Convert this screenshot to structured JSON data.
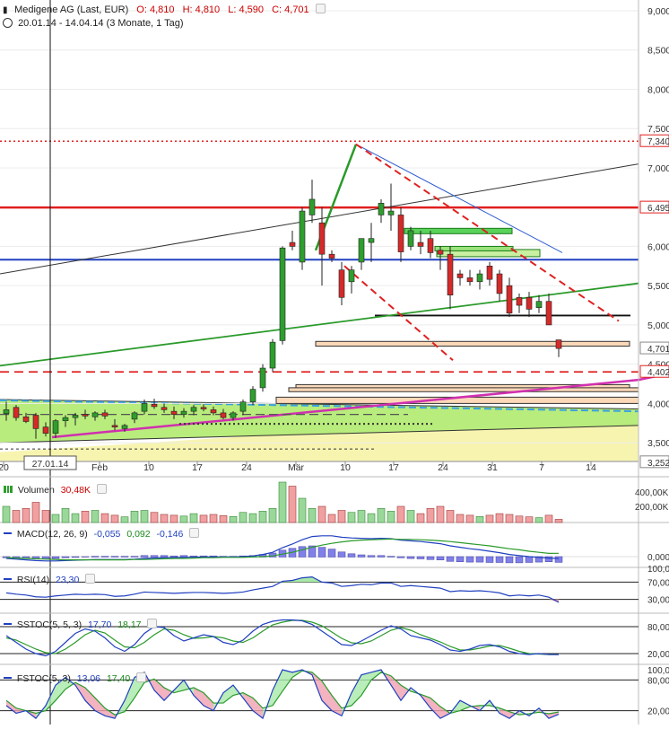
{
  "header": {
    "title": "Medigene AG (Last, EUR)",
    "open_label": "O:",
    "open": "4,810",
    "high_label": "H:",
    "high": "4,810",
    "low_label": "L:",
    "low": "4,590",
    "close_label": "C:",
    "close": "4,701",
    "period": "20.01.14 - 14.04.14 (3 Monate, 1 Tag)"
  },
  "colors": {
    "up": "#2e9e2e",
    "down": "#d42a2a",
    "red_line": "#e02020",
    "blue_line": "#2040c0",
    "green_line": "#2a9a2a",
    "magenta": "#d030b0",
    "orange_fill": "#fbd8b8",
    "green_zone": "#b8ec7c",
    "yellow_zone": "#f7f4b0"
  },
  "chart_data": [
    {
      "type": "candlestick",
      "name": "main",
      "x_ticks": [
        "20",
        "Feb",
        "10",
        "17",
        "24",
        "Mär",
        "10",
        "17",
        "24",
        "31",
        "7",
        "14"
      ],
      "crosshair_date": "27.01.14",
      "y_ticks": [
        "9,000",
        "8,500",
        "8,000",
        "7,500",
        "7,000",
        "6,500",
        "6,000",
        "5,500",
        "5,000",
        "4,500",
        "4,000",
        "3,500"
      ],
      "price_labels": [
        "7,340",
        "6,495",
        "4,701",
        "4,402",
        "3,252"
      ],
      "ylim": [
        3.25,
        9.0
      ],
      "candles": [
        [
          3.87,
          4.02,
          3.78,
          3.92
        ],
        [
          3.95,
          3.98,
          3.78,
          3.82
        ],
        [
          3.83,
          3.88,
          3.75,
          3.77
        ],
        [
          3.85,
          3.88,
          3.55,
          3.68
        ],
        [
          3.7,
          3.76,
          3.58,
          3.62
        ],
        [
          3.62,
          3.8,
          3.56,
          3.78
        ],
        [
          3.78,
          3.85,
          3.7,
          3.82
        ],
        [
          3.82,
          3.88,
          3.72,
          3.85
        ],
        [
          3.86,
          3.92,
          3.8,
          3.84
        ],
        [
          3.83,
          3.9,
          3.78,
          3.88
        ],
        [
          3.88,
          3.92,
          3.8,
          3.84
        ],
        [
          3.72,
          3.8,
          3.66,
          3.7
        ],
        [
          3.68,
          3.74,
          3.64,
          3.72
        ],
        [
          3.8,
          3.9,
          3.75,
          3.88
        ],
        [
          3.9,
          4.05,
          3.86,
          4.0
        ],
        [
          3.99,
          4.06,
          3.93,
          3.96
        ],
        [
          3.95,
          4.0,
          3.88,
          3.92
        ],
        [
          3.9,
          3.96,
          3.8,
          3.86
        ],
        [
          3.86,
          3.94,
          3.82,
          3.9
        ],
        [
          3.9,
          3.98,
          3.85,
          3.95
        ],
        [
          3.95,
          3.99,
          3.9,
          3.93
        ],
        [
          3.92,
          3.96,
          3.85,
          3.88
        ],
        [
          3.88,
          3.93,
          3.8,
          3.82
        ],
        [
          3.82,
          3.9,
          3.78,
          3.88
        ],
        [
          3.9,
          4.05,
          3.85,
          4.02
        ],
        [
          4.02,
          4.22,
          3.98,
          4.18
        ],
        [
          4.2,
          4.5,
          4.15,
          4.45
        ],
        [
          4.45,
          4.82,
          4.4,
          4.78
        ],
        [
          4.8,
          6.0,
          4.75,
          5.98
        ],
        [
          6.05,
          6.2,
          5.95,
          6.0
        ],
        [
          5.8,
          6.5,
          5.7,
          6.45
        ],
        [
          6.4,
          6.85,
          6.3,
          6.6
        ],
        [
          6.3,
          6.5,
          5.5,
          5.9
        ],
        [
          5.9,
          5.95,
          5.8,
          5.85
        ],
        [
          5.7,
          5.8,
          5.25,
          5.35
        ],
        [
          5.55,
          5.75,
          5.4,
          5.7
        ],
        [
          5.8,
          6.1,
          5.7,
          6.1
        ],
        [
          6.05,
          6.3,
          5.8,
          6.1
        ],
        [
          6.4,
          6.6,
          6.3,
          6.55
        ],
        [
          6.4,
          6.8,
          6.2,
          6.45
        ],
        [
          6.4,
          6.5,
          5.8,
          5.93
        ],
        [
          6.0,
          6.25,
          5.95,
          6.2
        ],
        [
          6.05,
          6.2,
          5.9,
          6.0
        ],
        [
          6.1,
          6.2,
          5.85,
          5.92
        ],
        [
          5.95,
          6.0,
          5.7,
          5.9
        ],
        [
          5.9,
          6.0,
          5.2,
          5.38
        ],
        [
          5.65,
          5.7,
          5.5,
          5.6
        ],
        [
          5.6,
          5.7,
          5.5,
          5.55
        ],
        [
          5.55,
          5.7,
          5.45,
          5.65
        ],
        [
          5.75,
          5.8,
          5.5,
          5.58
        ],
        [
          5.65,
          5.7,
          5.3,
          5.4
        ],
        [
          5.5,
          5.6,
          5.1,
          5.15
        ],
        [
          5.35,
          5.4,
          5.15,
          5.25
        ],
        [
          5.35,
          5.42,
          5.1,
          5.2
        ],
        [
          5.22,
          5.38,
          5.15,
          5.3
        ],
        [
          5.3,
          5.4,
          5.0,
          5.0
        ],
        [
          4.81,
          4.81,
          4.59,
          4.7
        ]
      ]
    },
    {
      "type": "bar",
      "name": "volume",
      "label": "Volumen",
      "current": "30,48K",
      "y_ticks": [
        "400,00K",
        "200,00K"
      ],
      "values": [
        40,
        30,
        35,
        50,
        30,
        20,
        35,
        22,
        28,
        30,
        22,
        18,
        14,
        28,
        30,
        25,
        20,
        18,
        16,
        22,
        18,
        20,
        17,
        15,
        25,
        22,
        28,
        35,
        100,
        90,
        60,
        35,
        40,
        20,
        30,
        25,
        30,
        22,
        35,
        28,
        40,
        30,
        22,
        35,
        40,
        30,
        20,
        18,
        15,
        18,
        22,
        20,
        16,
        14,
        12,
        18,
        8
      ]
    },
    {
      "type": "line",
      "name": "macd",
      "label": "MACD(12, 26, 9)",
      "values_shown": [
        "-0,055",
        "0,092",
        "-0,146"
      ],
      "y_ticks": [
        "0,000"
      ],
      "macd": [
        -0.05,
        -0.07,
        -0.09,
        -0.11,
        -0.12,
        -0.12,
        -0.11,
        -0.1,
        -0.09,
        -0.08,
        -0.08,
        -0.08,
        -0.08,
        -0.07,
        -0.05,
        -0.04,
        -0.03,
        -0.03,
        -0.02,
        -0.02,
        -0.01,
        -0.01,
        -0.01,
        -0.01,
        0.0,
        0.02,
        0.06,
        0.12,
        0.25,
        0.35,
        0.47,
        0.56,
        0.58,
        0.58,
        0.54,
        0.52,
        0.51,
        0.5,
        0.51,
        0.5,
        0.46,
        0.44,
        0.42,
        0.39,
        0.36,
        0.3,
        0.26,
        0.22,
        0.19,
        0.15,
        0.11,
        0.06,
        0.03,
        0.0,
        -0.02,
        -0.04,
        -0.055
      ],
      "signal": [
        -0.03,
        -0.04,
        -0.05,
        -0.06,
        -0.07,
        -0.08,
        -0.09,
        -0.09,
        -0.09,
        -0.09,
        -0.09,
        -0.09,
        -0.09,
        -0.08,
        -0.08,
        -0.07,
        -0.06,
        -0.05,
        -0.05,
        -0.04,
        -0.03,
        -0.03,
        -0.02,
        -0.02,
        -0.02,
        -0.01,
        0.0,
        0.02,
        0.07,
        0.12,
        0.19,
        0.26,
        0.32,
        0.37,
        0.41,
        0.44,
        0.46,
        0.47,
        0.48,
        0.49,
        0.48,
        0.48,
        0.47,
        0.46,
        0.44,
        0.42,
        0.39,
        0.36,
        0.33,
        0.3,
        0.26,
        0.22,
        0.19,
        0.15,
        0.12,
        0.09,
        0.092
      ]
    },
    {
      "type": "line",
      "name": "rsi",
      "label": "RSI(14)",
      "values_shown": [
        "23,30"
      ],
      "y_ticks": [
        "100,00",
        "70,00",
        "30,00"
      ],
      "values": [
        45,
        42,
        40,
        36,
        35,
        38,
        40,
        42,
        41,
        42,
        41,
        37,
        38,
        42,
        47,
        46,
        45,
        44,
        45,
        46,
        46,
        45,
        44,
        45,
        47,
        52,
        56,
        60,
        72,
        74,
        80,
        82,
        70,
        68,
        60,
        62,
        65,
        64,
        68,
        68,
        60,
        62,
        60,
        58,
        56,
        48,
        50,
        49,
        50,
        48,
        45,
        38,
        40,
        38,
        40,
        35,
        23.3
      ]
    },
    {
      "type": "line",
      "name": "sstoc",
      "label": "SSTOC(5, 5, 3)",
      "values_shown": [
        "17,70",
        "18,17"
      ],
      "y_ticks": [
        "80,00",
        "20,00"
      ],
      "k": [
        60,
        45,
        30,
        20,
        15,
        25,
        45,
        65,
        75,
        70,
        55,
        35,
        25,
        40,
        65,
        80,
        78,
        60,
        48,
        55,
        62,
        58,
        45,
        40,
        50,
        70,
        85,
        92,
        95,
        95,
        93,
        85,
        70,
        55,
        40,
        38,
        48,
        60,
        72,
        82,
        75,
        60,
        55,
        50,
        40,
        28,
        25,
        30,
        38,
        40,
        35,
        25,
        20,
        18,
        20,
        18,
        17.7
      ],
      "d": [
        55,
        50,
        40,
        30,
        22,
        20,
        30,
        45,
        62,
        72,
        66,
        50,
        35,
        33,
        45,
        62,
        75,
        72,
        62,
        54,
        55,
        58,
        55,
        48,
        45,
        55,
        70,
        84,
        90,
        94,
        94,
        90,
        82,
        68,
        54,
        44,
        42,
        48,
        60,
        72,
        78,
        72,
        62,
        54,
        46,
        36,
        28,
        28,
        32,
        37,
        38,
        32,
        25,
        20,
        19,
        18,
        18.17
      ]
    },
    {
      "type": "line",
      "name": "fstoc",
      "label": "FSTOC(5, 3)",
      "values_shown": [
        "13,06",
        "17,40"
      ],
      "y_ticks": [
        "100,00",
        "80,00",
        "20,00"
      ],
      "k": [
        30,
        15,
        20,
        5,
        30,
        70,
        85,
        70,
        40,
        20,
        10,
        5,
        40,
        85,
        95,
        60,
        40,
        60,
        80,
        50,
        30,
        20,
        55,
        70,
        45,
        20,
        5,
        60,
        100,
        95,
        100,
        90,
        40,
        20,
        10,
        55,
        90,
        95,
        100,
        70,
        40,
        65,
        50,
        25,
        5,
        15,
        40,
        30,
        20,
        40,
        15,
        5,
        20,
        10,
        25,
        5,
        13.06
      ],
      "d": [
        40,
        25,
        20,
        15,
        20,
        40,
        62,
        75,
        65,
        45,
        25,
        12,
        18,
        45,
        75,
        82,
        65,
        55,
        60,
        65,
        55,
        35,
        35,
        50,
        55,
        45,
        25,
        30,
        58,
        85,
        98,
        95,
        78,
        50,
        25,
        30,
        50,
        80,
        95,
        88,
        70,
        58,
        52,
        45,
        28,
        15,
        20,
        28,
        30,
        30,
        25,
        18,
        12,
        14,
        17,
        14,
        17.4
      ]
    }
  ]
}
